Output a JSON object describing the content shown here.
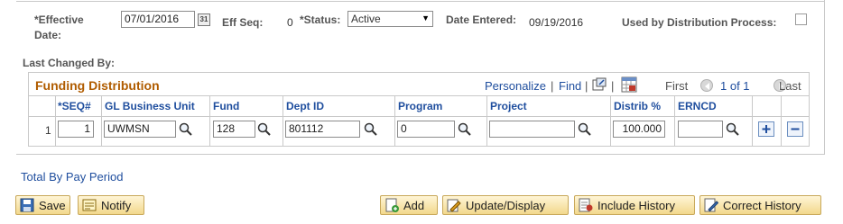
{
  "header": {
    "effective_date_label": "*Effective",
    "effective_date_label2": "Date:",
    "effective_date_value": "07/01/2016",
    "eff_seq_label": "Eff Seq:",
    "eff_seq_value": "0",
    "status_label": "*Status:",
    "status_value": "Active",
    "date_entered_label": "Date Entered:",
    "date_entered_value": "09/19/2016",
    "used_by_label": "Used by Distribution Process:",
    "last_changed_label": "Last Changed By:"
  },
  "grid": {
    "title": "Funding Distribution",
    "personalize": "Personalize",
    "find": "Find",
    "first": "First",
    "page_info": "1 of 1",
    "last": "Last",
    "columns": [
      "*SEQ#",
      "GL Business Unit",
      "Fund",
      "Dept ID",
      "Program",
      "Project",
      "Distrib %",
      "ERNCD"
    ],
    "row": {
      "num": "1",
      "seq": "1",
      "gl_business_unit": "UWMSN",
      "fund": "128",
      "dept_id": "801112",
      "program": "0",
      "project": "",
      "distrib_pct": "100.000",
      "erncd": ""
    }
  },
  "links": {
    "total_by_pay_period": "Total By Pay Period"
  },
  "buttons": {
    "save": "Save",
    "notify": "Notify",
    "add": "Add",
    "update_display": "Update/Display",
    "include_history": "Include History",
    "correct_history": "Correct History"
  },
  "icons": {
    "calendar": "calendar-icon",
    "lookup": "magnifier-icon",
    "add_row": "plus-icon",
    "delete_row": "minus-icon"
  },
  "colors": {
    "grid_title": "#b05c00",
    "link": "#1f4e9e",
    "button_bg": "#f2d88c"
  }
}
